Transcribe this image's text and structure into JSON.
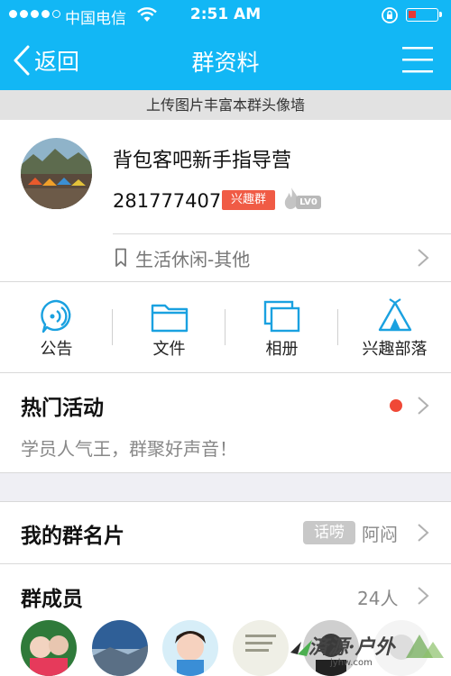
{
  "status_bar": {
    "carrier": "中国电信",
    "time": "2:51 AM"
  },
  "nav": {
    "back_label": "返回",
    "title": "群资料"
  },
  "banner": {
    "text": "上传图片丰富本群头像墙"
  },
  "group": {
    "name": "背包客吧新手指导营",
    "id": "281777407",
    "tag": "兴趣群",
    "level": "LV0",
    "category": "生活休闲-其他"
  },
  "actions": [
    {
      "label": "公告",
      "icon": "announcement-icon"
    },
    {
      "label": "文件",
      "icon": "folder-icon"
    },
    {
      "label": "相册",
      "icon": "album-icon"
    },
    {
      "label": "兴趣部落",
      "icon": "tent-icon"
    }
  ],
  "hot_activity": {
    "title": "热门活动",
    "subtitle": "学员人气王，群聚好声音！"
  },
  "my_card": {
    "title": "我的群名片",
    "tag": "话唠",
    "nickname": "阿闷"
  },
  "members": {
    "title": "群成员",
    "count": "24人"
  },
  "watermark": {
    "text": "済源·户外",
    "url": "jyhw.com"
  },
  "colors": {
    "brand": "#12b7f5",
    "interest_tag": "#f05b45",
    "red_dot": "#f04836",
    "icon_blue": "#1aa1e0"
  }
}
